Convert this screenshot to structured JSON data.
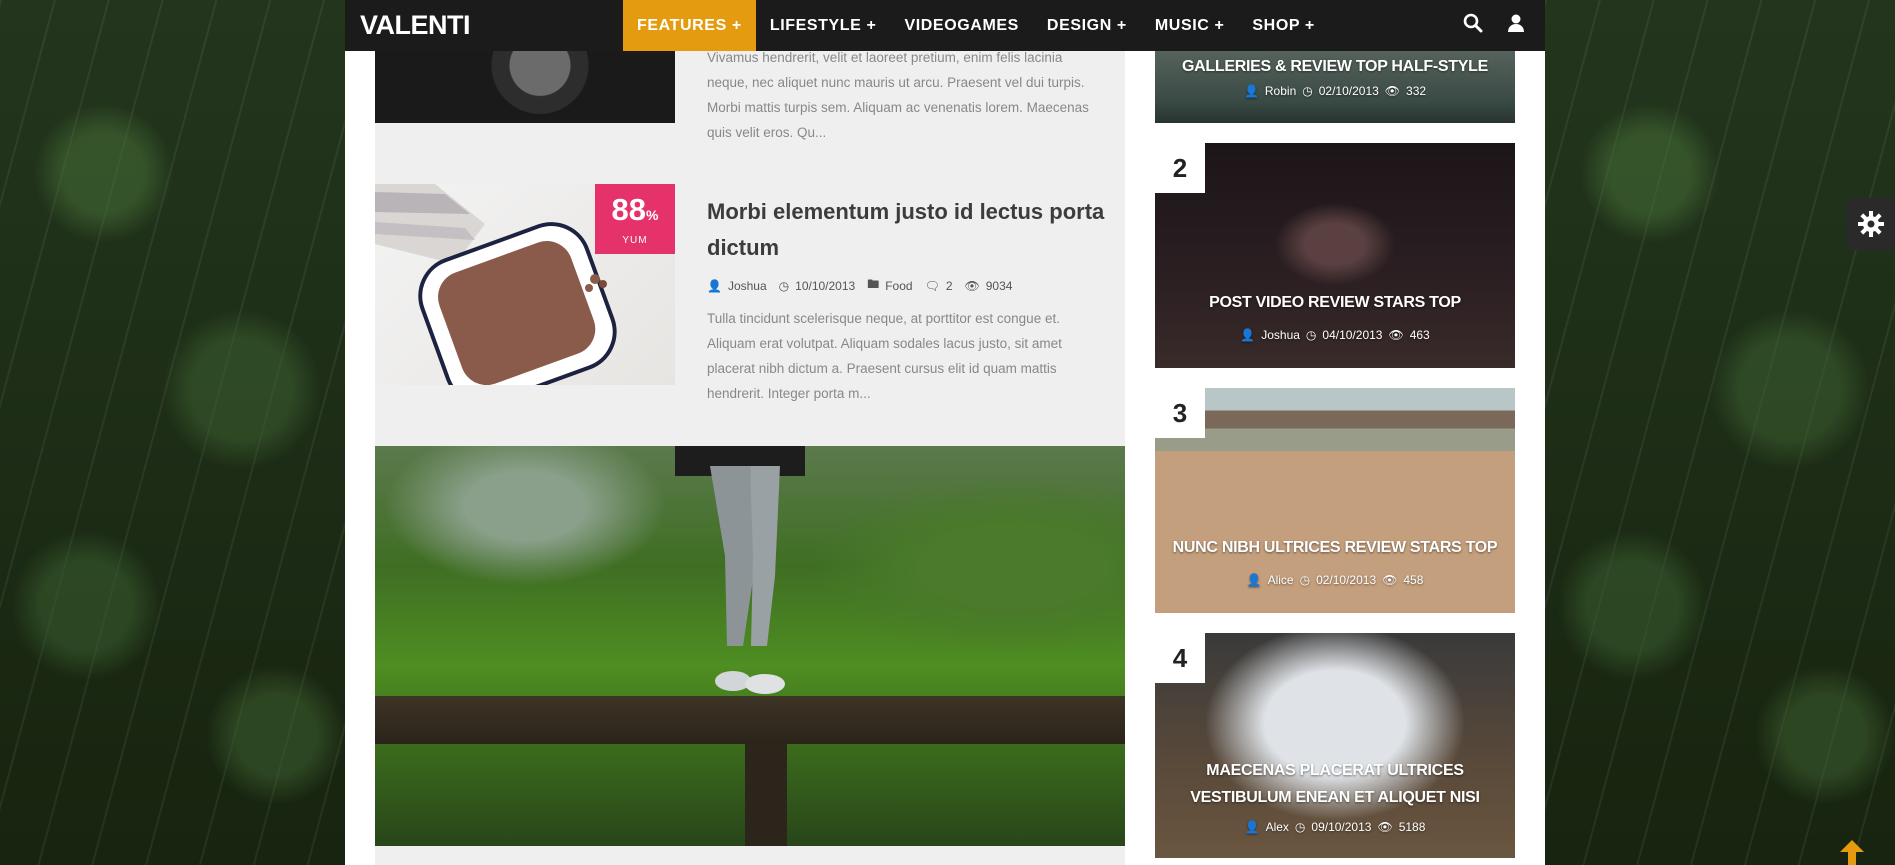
{
  "brand": {
    "logo": "VALENTI",
    "accent": "#e49b0f",
    "score_color": "#e5326a"
  },
  "nav": {
    "items": [
      {
        "label": "FEATURES +",
        "active": true
      },
      {
        "label": "LIFESTYLE +"
      },
      {
        "label": "VIDEOGAMES"
      },
      {
        "label": "DESIGN +"
      },
      {
        "label": "MUSIC +"
      },
      {
        "label": "SHOP +"
      }
    ],
    "icons": [
      "search-icon",
      "user-icon"
    ]
  },
  "articles": [
    {
      "excerpt": "Vivamus hendrerit, velit et laoreet pretium, enim felis lacinia neque, nec aliquet nunc mauris ut arcu. Praesent vel dui turpis. Morbi mattis turpis sem. Aliquam ac venenatis lorem. Maecenas quis velit eros. Qu..."
    },
    {
      "title": "Morbi elementum justo id lectus porta dictum",
      "score": "88",
      "score_unit": "%",
      "score_label": "YUM",
      "author": "Joshua",
      "date": "10/10/2013",
      "category": "Food",
      "comments": "2",
      "views": "9034",
      "excerpt": "Tulla tincidunt scelerisque neque, at porttitor est congue et. Aliquam erat volutpat. Aliquam sodales lacus justo, sit amet placerat nibh dictum a. Praesent cursus elit id quam mattis hendrerit. Integer porta m..."
    }
  ],
  "sidebar": {
    "cards": [
      {
        "title": "GALLERIES & REVIEW TOP HALF-STYLE",
        "author": "Robin",
        "date": "02/10/2013",
        "views": "332"
      },
      {
        "rank": "2",
        "title": "POST VIDEO REVIEW STARS TOP",
        "author": "Joshua",
        "date": "04/10/2013",
        "views": "463"
      },
      {
        "rank": "3",
        "title": "NUNC NIBH ULTRICES REVIEW STARS TOP",
        "author": "Alice",
        "date": "02/10/2013",
        "views": "458"
      },
      {
        "rank": "4",
        "title": "MAECENAS PLACERAT ULTRICES VESTIBULUM ENEAN ET ALIQUET NISI",
        "author": "Alex",
        "date": "09/10/2013",
        "views": "5188"
      }
    ]
  }
}
